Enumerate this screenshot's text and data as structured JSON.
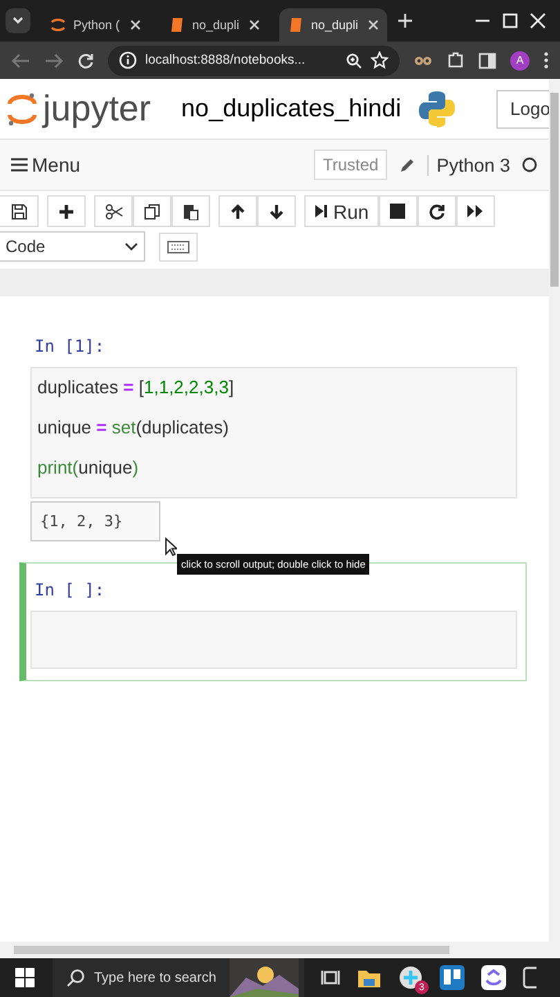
{
  "browser": {
    "tabs": [
      {
        "label": "Python (",
        "kind": "jupyter",
        "selected": false
      },
      {
        "label": "no_dupli",
        "kind": "notebook",
        "selected": false
      },
      {
        "label": "no_dupli",
        "kind": "notebook",
        "selected": true
      }
    ],
    "address": "localhost:8888/notebooks...",
    "profile_initial": "A"
  },
  "header": {
    "logo_text": "jupyter",
    "notebook_title": "no_duplicates_hindi",
    "logout_label": "Logo"
  },
  "menubar": {
    "menu_label": "Menu",
    "trusted_label": "Trusted",
    "kernel_name": "Python 3"
  },
  "toolbar": {
    "run_label": "Run",
    "cell_type": "Code"
  },
  "cells": [
    {
      "prompt": "In [1]:",
      "selected": false,
      "lines": [
        [
          {
            "text": "duplicates",
            "kind": "name"
          },
          {
            "text": " = ",
            "kind": "op"
          },
          {
            "text": "[",
            "kind": "plain"
          },
          {
            "text": "1,1,2,2,3,3",
            "kind": "number"
          },
          {
            "text": "]",
            "kind": "plain"
          }
        ],
        [
          {
            "text": "unique",
            "kind": "name"
          },
          {
            "text": " = ",
            "kind": "op"
          },
          {
            "text": "set",
            "kind": "builtin"
          },
          {
            "text": "(duplicates)",
            "kind": "plain"
          }
        ],
        [
          {
            "text": "print",
            "kind": "builtin"
          },
          {
            "text": "(",
            "kind": "builtin"
          },
          {
            "text": "unique",
            "kind": "plain"
          },
          {
            "text": ")",
            "kind": "builtin"
          }
        ]
      ],
      "output": "{1, 2, 3}"
    },
    {
      "prompt": "In [ ]:",
      "selected": true
    }
  ],
  "tooltip": "click to scroll output; double click to hide",
  "taskbar": {
    "search_placeholder": "Type here to search",
    "notification_count": "3"
  }
}
